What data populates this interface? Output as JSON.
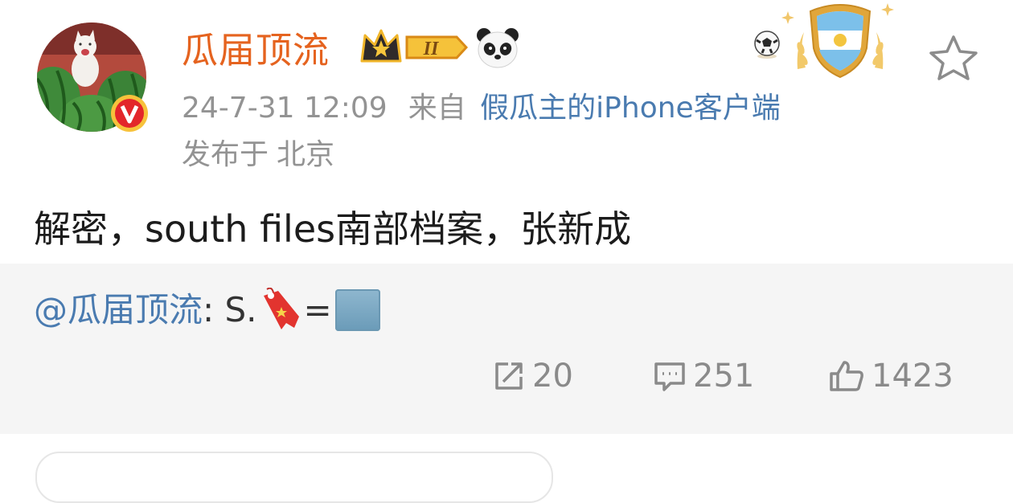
{
  "post": {
    "username": "瓜届顶流",
    "vip_level": "II",
    "timestamp": "24-7-31 12:09",
    "source_prefix": "来自",
    "client": "假瓜主的iPhone客户端",
    "location_prefix": "发布于",
    "location": "北京",
    "text": "解密，south files南部档案，张新成"
  },
  "repost": {
    "mention": "@瓜届顶流",
    "text": ": S.",
    "equals": "="
  },
  "stats": {
    "reposts": "20",
    "comments": "251",
    "likes": "1423"
  },
  "colors": {
    "username": "#e5631f",
    "link": "#4a7bb0",
    "meta": "#939393",
    "card_bg": "#f5f5f5"
  },
  "icons": [
    "avatar",
    "verified-badge-icon",
    "vip-crown-icon",
    "panda-icon",
    "soccer-ball-icon",
    "argentina-crest-icon",
    "star-icon",
    "repost-icon",
    "comment-icon",
    "thumbs-up-icon",
    "bookmark-emoji-icon",
    "square-emoji-icon"
  ]
}
